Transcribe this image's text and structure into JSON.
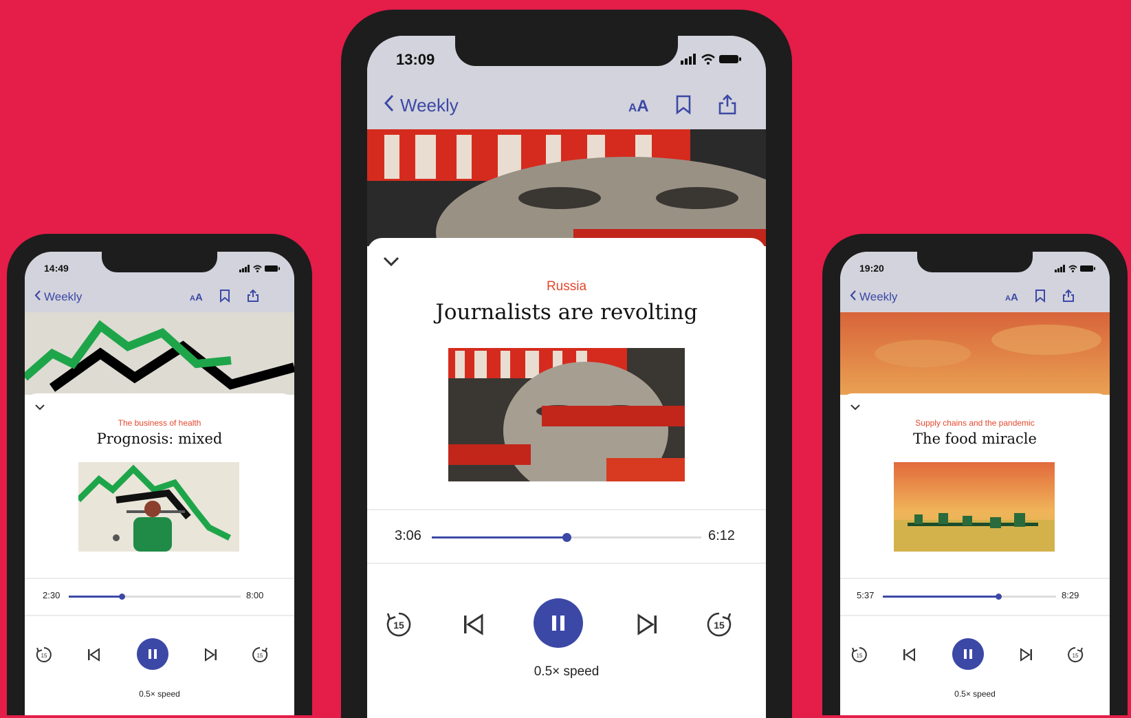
{
  "colors": {
    "background": "#e41d49",
    "accent": "#3c48a6",
    "rubric": "#e3462c"
  },
  "phones": [
    {
      "status_time": "14:49",
      "nav": {
        "back_label": "Weekly",
        "text_size_icon": "text-size-icon",
        "bookmark_icon": "bookmark-icon",
        "share_icon": "share-icon"
      },
      "rubric": "The business of health",
      "title": "Prognosis: mixed",
      "elapsed": "2:30",
      "duration": "8:00",
      "progress": 0.31,
      "speed_label": "0.5× speed"
    },
    {
      "status_time": "13:09",
      "nav": {
        "back_label": "Weekly",
        "text_size_icon": "text-size-icon",
        "bookmark_icon": "bookmark-icon",
        "share_icon": "share-icon"
      },
      "rubric": "Russia",
      "title": "Journalists are revolting",
      "elapsed": "3:06",
      "duration": "6:12",
      "progress": 0.5,
      "speed_label": "0.5× speed"
    },
    {
      "status_time": "19:20",
      "nav": {
        "back_label": "Weekly",
        "text_size_icon": "text-size-icon",
        "bookmark_icon": "bookmark-icon",
        "share_icon": "share-icon"
      },
      "rubric": "Supply chains and the pandemic",
      "title": "The food miracle",
      "elapsed": "5:37",
      "duration": "8:29",
      "progress": 0.67,
      "speed_label": "0.5× speed"
    }
  ]
}
